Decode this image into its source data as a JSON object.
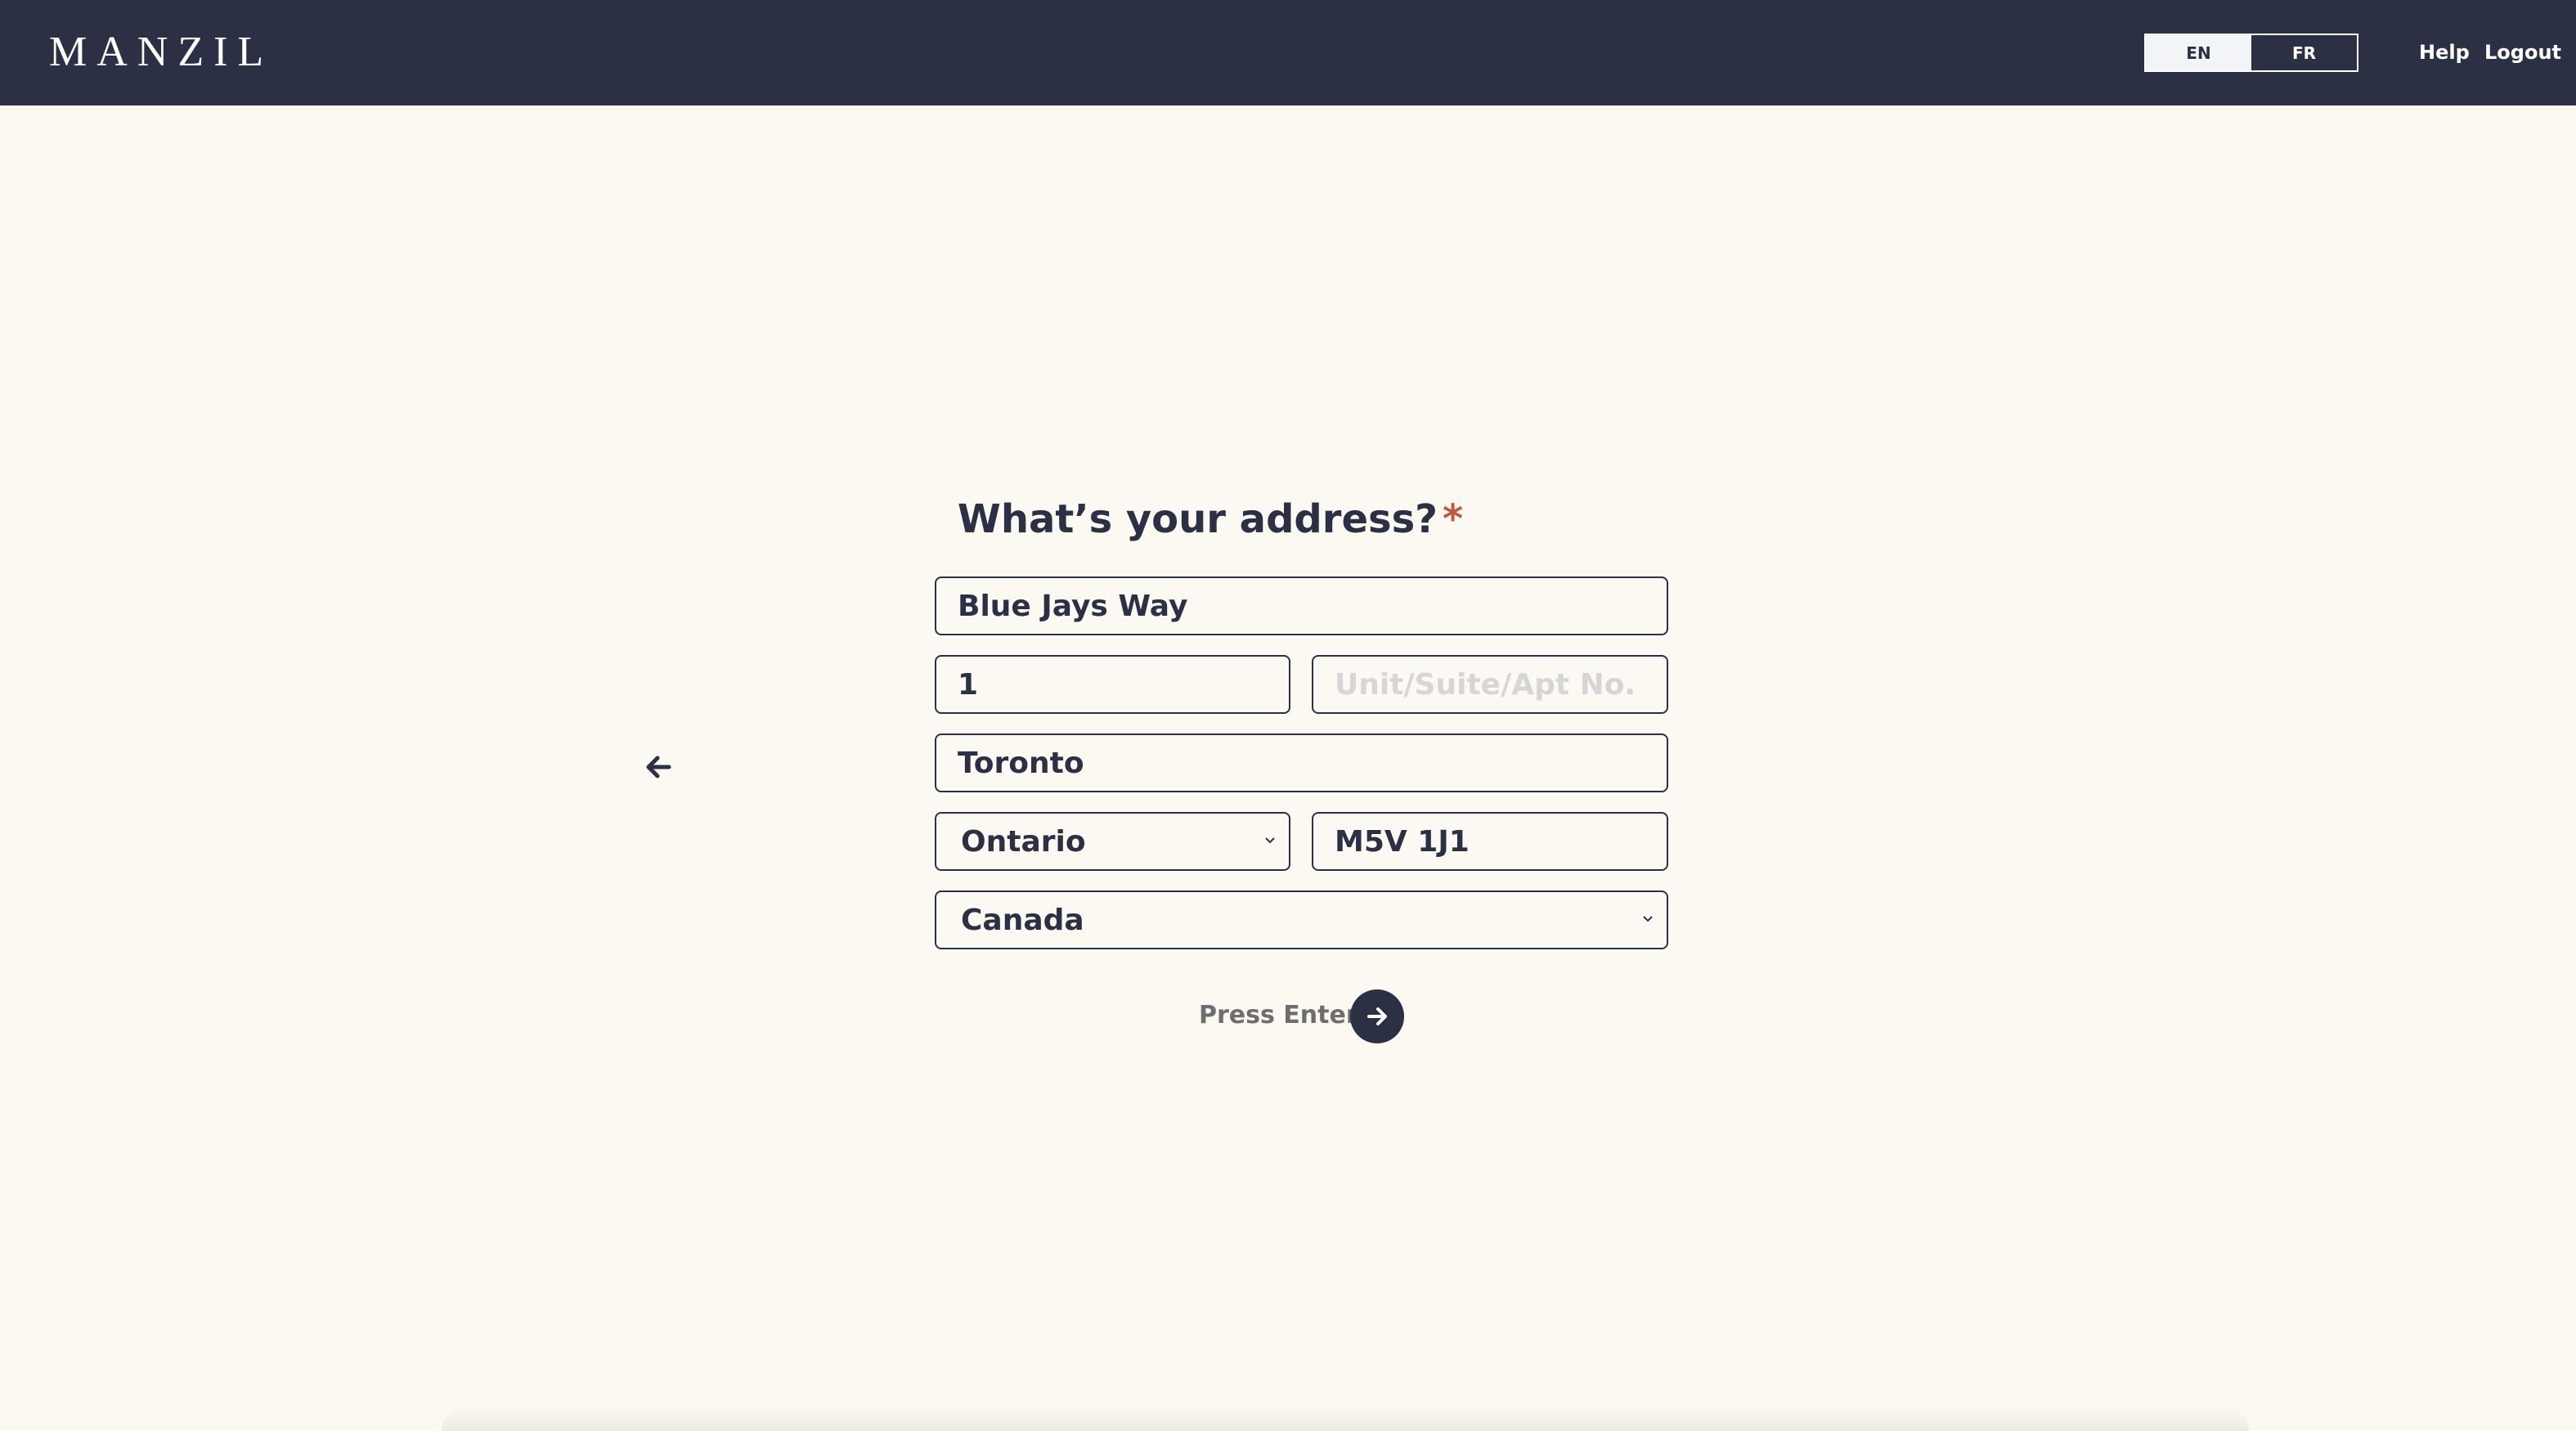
{
  "header": {
    "logo": "MANZIL",
    "languages": [
      {
        "label": "EN",
        "active": true
      },
      {
        "label": "FR",
        "active": false
      }
    ],
    "help": "Help",
    "logout": "Logout"
  },
  "form": {
    "question": "What’s your address?",
    "required_mark": "*",
    "street": {
      "value": "Blue Jays Way",
      "placeholder": ""
    },
    "street_number": {
      "value": "1",
      "placeholder": ""
    },
    "unit": {
      "value": "",
      "placeholder": "Unit/Suite/Apt No."
    },
    "city": {
      "value": "Toronto",
      "placeholder": ""
    },
    "province": {
      "selected": "Ontario"
    },
    "postal_code": {
      "value": "M5V 1J1",
      "placeholder": ""
    },
    "country": {
      "selected": "Canada"
    },
    "submit_hint": "Press Enter"
  },
  "colors": {
    "navy": "#2b3045",
    "background": "#fcf9f2",
    "required": "#c0583f"
  },
  "icons": {
    "back": "arrow-left-icon",
    "submit": "arrow-right-icon",
    "select": "chevron-down-icon"
  }
}
